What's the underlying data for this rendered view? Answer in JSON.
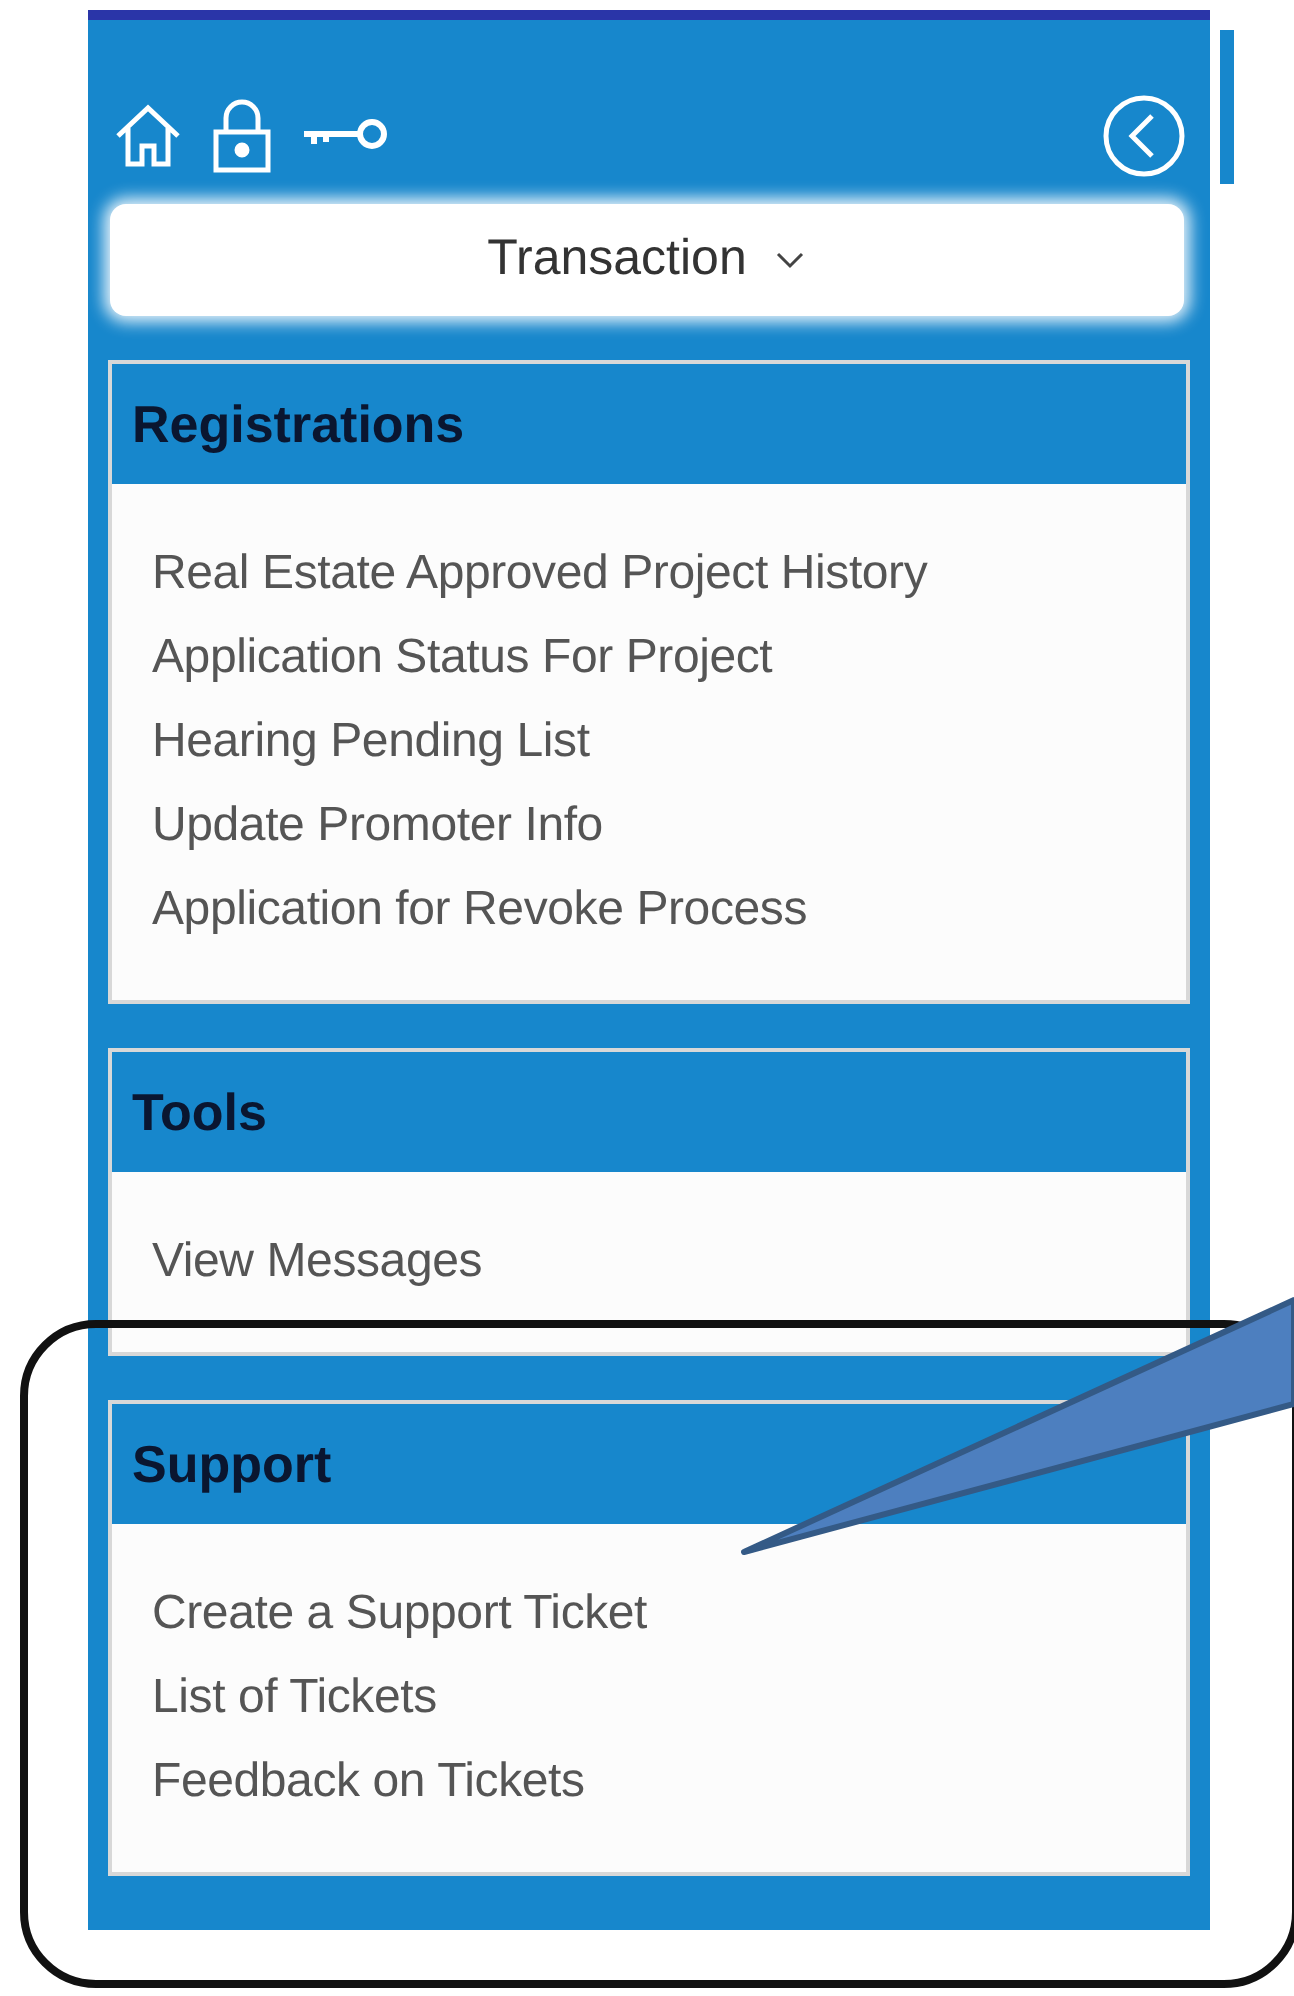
{
  "toolbar": {
    "dropdown": {
      "label": "Transaction"
    }
  },
  "sections": [
    {
      "title": "Registrations",
      "items": [
        "Real Estate Approved Project History",
        "Application Status For Project",
        "Hearing Pending List",
        "Update Promoter Info",
        "Application for Revoke Process"
      ]
    },
    {
      "title": "Tools",
      "items": [
        "View Messages"
      ]
    },
    {
      "title": "Support",
      "items": [
        "Create a Support Ticket",
        "List of Tickets",
        "Feedback on Tickets"
      ]
    }
  ]
}
